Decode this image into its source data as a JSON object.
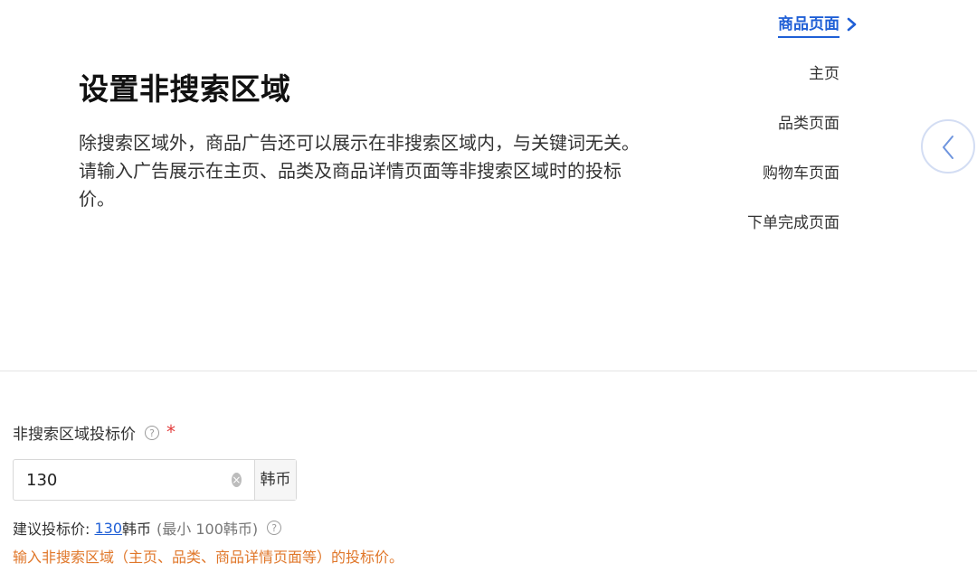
{
  "section": {
    "title": "设置非搜索区域",
    "desc_line1": "除搜索区域外，商品广告还可以展示在非搜索区域内，与关键词无关。",
    "desc_line2": "请输入广告展示在主页、品类及商品详情页面等非搜索区域时的投标",
    "desc_line3": "价。"
  },
  "nav": {
    "items": [
      {
        "label": "商品页面",
        "active": true
      },
      {
        "label": "主页"
      },
      {
        "label": "品类页面"
      },
      {
        "label": "购物车页面"
      },
      {
        "label": "下单完成页面"
      }
    ]
  },
  "field": {
    "label": "非搜索区域投标价",
    "required_mark": "*",
    "help_glyph": "?",
    "value": "130",
    "unit": "韩币"
  },
  "suggest": {
    "prefix": "建议投标价: ",
    "value": "130",
    "unit": "韩币",
    "min_text": "(最小 100韩币)"
  },
  "hint": "输入非搜索区域（主页、品类、商品详情页面等）的投标价。",
  "colors": {
    "accent": "#1f5fd6",
    "warning": "#e0772a",
    "required": "#e23b3b"
  }
}
